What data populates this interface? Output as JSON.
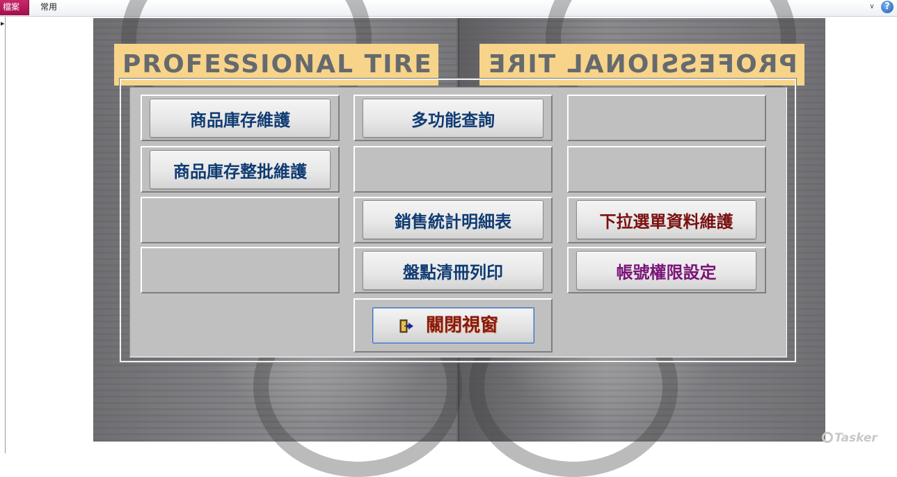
{
  "ribbon": {
    "file_tab": "檔案",
    "home_tab": "常用",
    "minimize_glyph": "∨",
    "help_glyph": "?"
  },
  "nav_arrow_glyph": "▶",
  "banner": {
    "left_text": "PROFESSIONAL TIRE",
    "right_text": "PROFESSIONAL TIRE"
  },
  "menu": {
    "inventory_maintenance": "商品庫存維護",
    "batch_inventory_maintenance": "商品庫存整批維護",
    "multi_function_query": "多功能查詢",
    "sales_statistics_detail": "銷售統計明細表",
    "stocktake_list_print": "盤點清冊列印",
    "dropdown_data_maintenance": "下拉選單資料維護",
    "account_permission_settings": "帳號權限設定",
    "close_window": "關閉視窗"
  },
  "colors": {
    "file_tab": "#b0185a",
    "button_blue": "#0f3b73",
    "button_darkred": "#7a1010",
    "button_purple": "#7a1478",
    "banner": "#f7d48a"
  },
  "watermark": "Tasker"
}
